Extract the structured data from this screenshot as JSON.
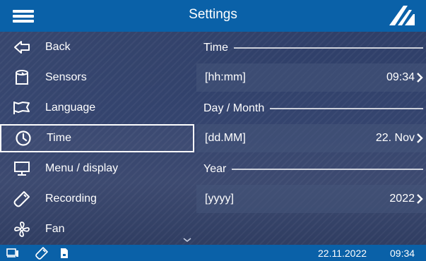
{
  "header": {
    "title": "Settings",
    "menu_icon": "hamburger-menu-icon",
    "logo_icon": "brand-logo-icon"
  },
  "sidebar": {
    "items": [
      {
        "label": "Back",
        "icon": "back-arrow-icon"
      },
      {
        "label": "Sensors",
        "icon": "sensor-icon"
      },
      {
        "label": "Language",
        "icon": "flag-icon"
      },
      {
        "label": "Time",
        "icon": "clock-icon",
        "selected": true
      },
      {
        "label": "Menu / display",
        "icon": "monitor-icon"
      },
      {
        "label": "Recording",
        "icon": "usb-stick-icon"
      },
      {
        "label": "Fan",
        "icon": "fan-icon"
      }
    ],
    "scroll_icon": "chevron-down-icon"
  },
  "panel": {
    "time": {
      "section": "Time",
      "format": "[hh:mm]",
      "value": "09:34"
    },
    "day_month": {
      "section": "Day / Month",
      "format": "[dd.MM]",
      "value": "22. Nov"
    },
    "year": {
      "section": "Year",
      "format": "[yyyy]",
      "value": "2022"
    }
  },
  "status": {
    "date": "22.11.2022",
    "time": "09:34",
    "icons": [
      "monitor-status-icon",
      "usb-stick-status-icon",
      "sd-card-status-icon"
    ]
  },
  "colors": {
    "accent_blue": "#0a61a8",
    "background": "#34446e",
    "text": "#ffffff"
  }
}
